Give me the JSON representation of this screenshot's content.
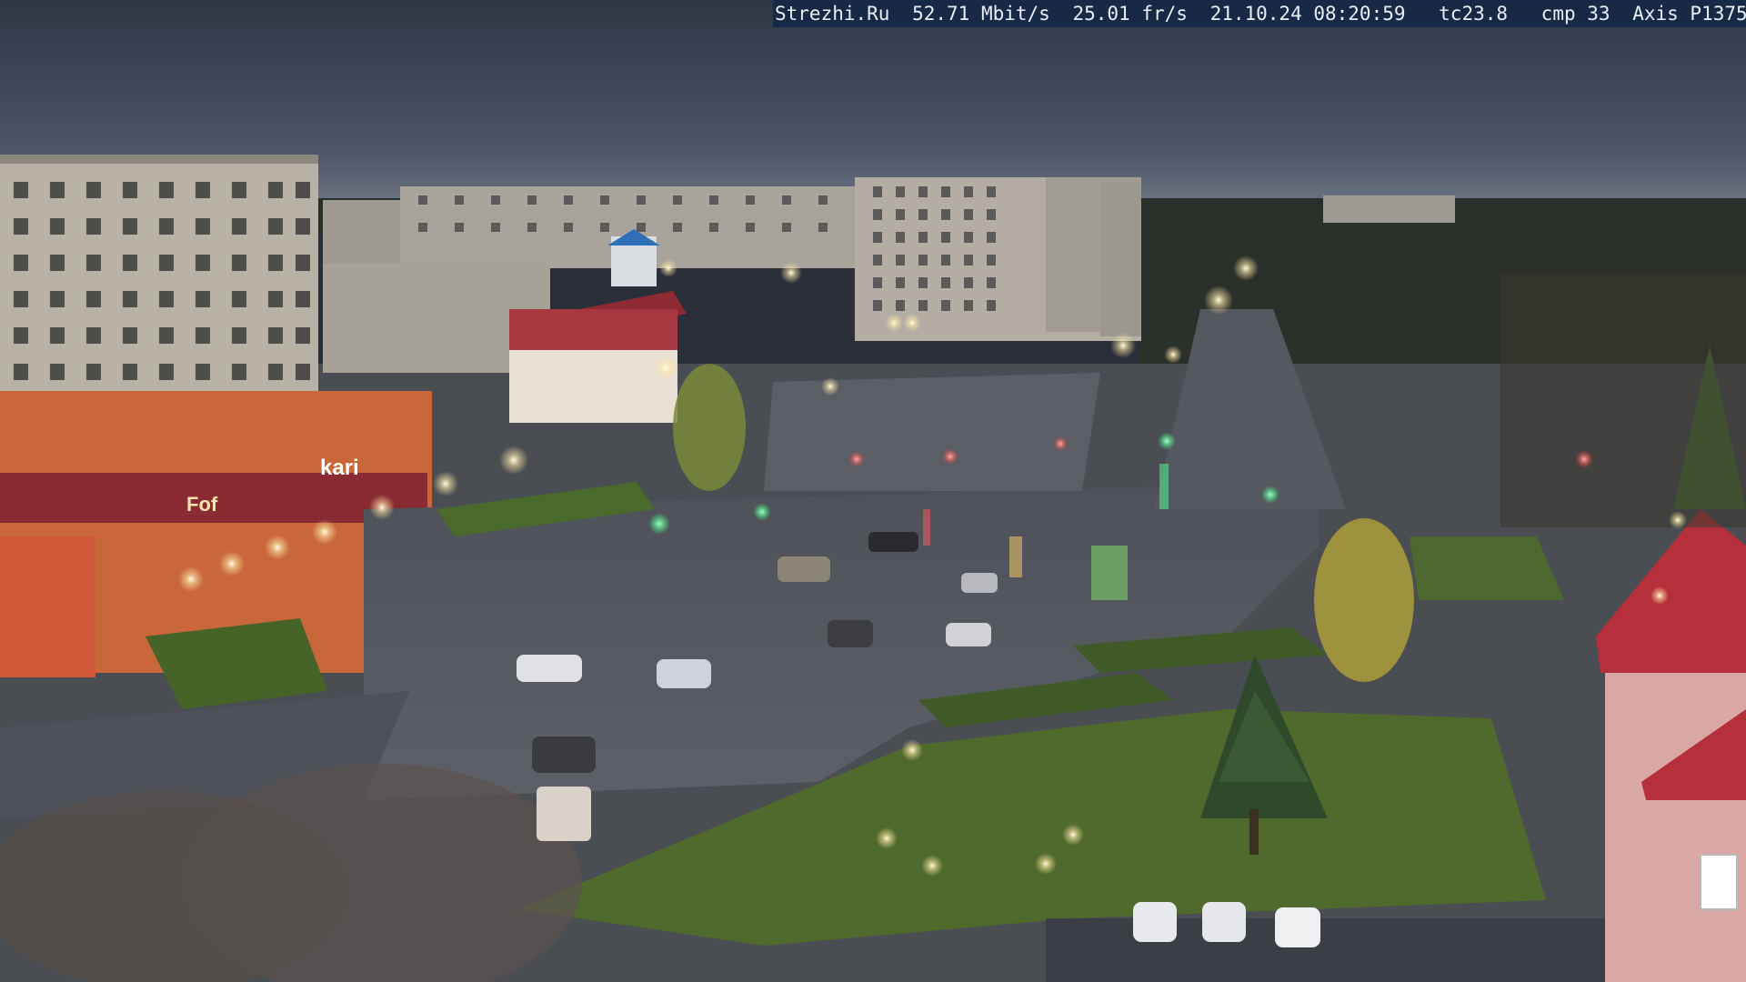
{
  "camera_overlay": {
    "site": "Strezhi.Ru",
    "bitrate": "52.71 Mbit/s",
    "framerate": "25.01 fr/s",
    "timestamp": "21.10.24 08:20:59",
    "temperature": "tc23.8",
    "compression": "cmp 33",
    "camera_model": "Axis P1375"
  },
  "signage": {
    "store_sign_1": "kari",
    "store_sign_2": "Fof"
  },
  "colors": {
    "sky_top": "#343c4c",
    "sky_horizon": "#6b7483",
    "road": "#55585e",
    "grass": "#4f6a2c",
    "panel_building": "#b7b1a6",
    "store_facade": "#c9663a",
    "red_roof": "#b5303a",
    "street_light": "#fff6d8",
    "traffic_green": "#2eff7a",
    "traffic_red": "#ff2a2a"
  }
}
